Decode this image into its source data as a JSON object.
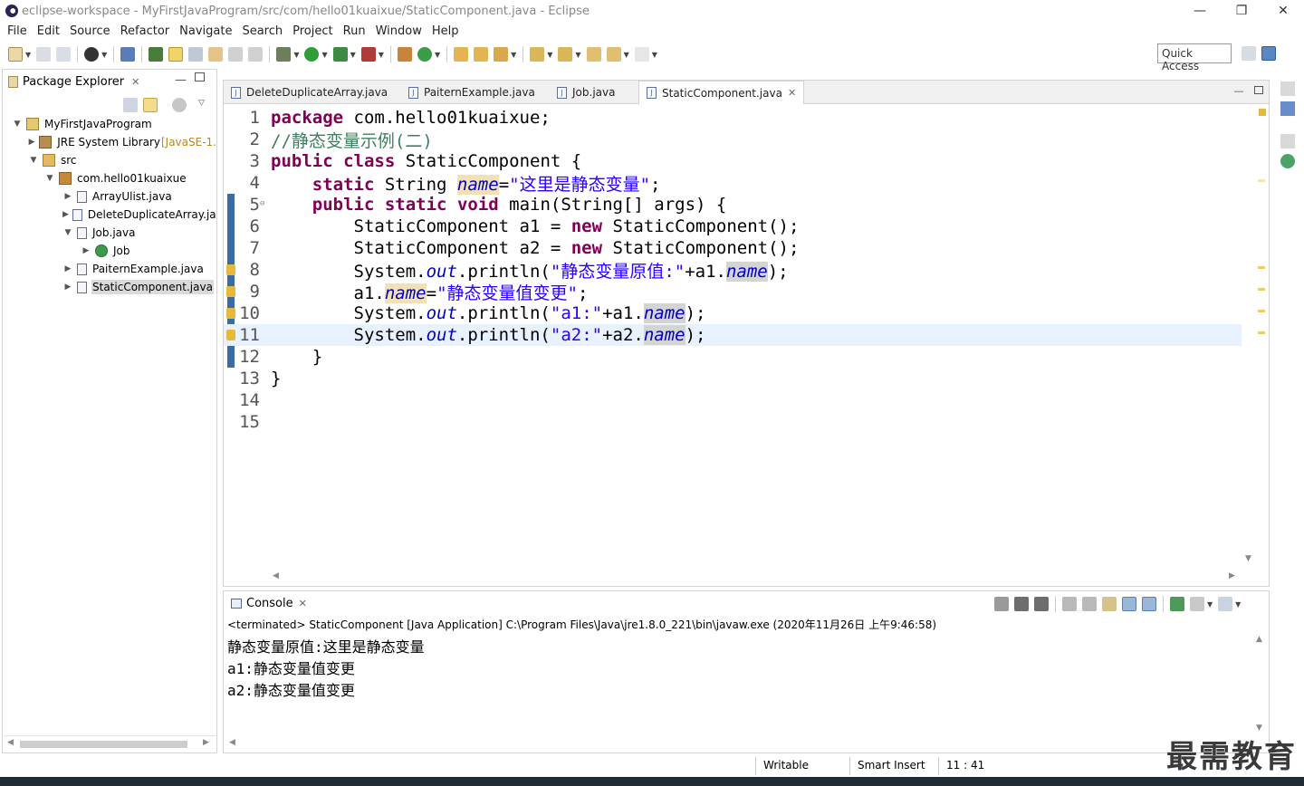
{
  "window": {
    "title": "eclipse-workspace - MyFirstJavaProgram/src/com/hello01kuaixue/StaticComponent.java - Eclipse",
    "minimize": "—",
    "restore": "❐",
    "close": "✕"
  },
  "menu": [
    "File",
    "Edit",
    "Source",
    "Refactor",
    "Navigate",
    "Search",
    "Project",
    "Run",
    "Window",
    "Help"
  ],
  "toolbar": {
    "quick_access": "Quick Access"
  },
  "package_explorer": {
    "title": "Package Explorer",
    "close": "✕",
    "tree": [
      {
        "label": "MyFirstJavaProgram",
        "decoration": "",
        "twisty": "▼",
        "icon": "project-icon"
      },
      {
        "label": "JRE System Library ",
        "decoration": "[JavaSE-1.",
        "twisty": "▶",
        "icon": "library-icon"
      },
      {
        "label": "src",
        "decoration": "",
        "twisty": "▼",
        "icon": "source-folder-icon"
      },
      {
        "label": "com.hello01kuaixue",
        "decoration": "",
        "twisty": "▼",
        "icon": "package-icon"
      },
      {
        "label": "ArrayUlist.java",
        "decoration": "",
        "twisty": "▶",
        "icon": "java-file-icon"
      },
      {
        "label": "DeleteDuplicateArray.ja",
        "decoration": "",
        "twisty": "▶",
        "icon": "java-file-icon"
      },
      {
        "label": "Job.java",
        "decoration": "",
        "twisty": "▼",
        "icon": "java-file-icon"
      },
      {
        "label": "Job",
        "decoration": "",
        "twisty": "▶",
        "icon": "class-icon"
      },
      {
        "label": "PaiternExample.java",
        "decoration": "",
        "twisty": "▶",
        "icon": "java-file-icon"
      },
      {
        "label": "StaticComponent.java",
        "decoration": "",
        "twisty": "▶",
        "icon": "java-file-icon"
      }
    ]
  },
  "editor": {
    "tabs": [
      {
        "label": "DeleteDuplicateArray.java",
        "active": false
      },
      {
        "label": "PaiternExample.java",
        "active": false
      },
      {
        "label": "Job.java",
        "active": false
      },
      {
        "label": "StaticComponent.java",
        "active": true
      }
    ],
    "tab_close": "✕",
    "line_numbers": [
      "1",
      "2",
      "3",
      "4",
      "5",
      "6",
      "7",
      "8",
      "9",
      "10",
      "11",
      "12",
      "13",
      "14",
      "15"
    ],
    "lines": [
      [
        {
          "t": "package",
          "c": "kw"
        },
        {
          "t": " com.hello01kuaixue;",
          "c": ""
        }
      ],
      [
        {
          "t": "//静态变量示例(二)",
          "c": "cmt"
        }
      ],
      [
        {
          "t": "public",
          "c": "kw"
        },
        {
          "t": " ",
          "c": ""
        },
        {
          "t": "class",
          "c": "kw"
        },
        {
          "t": " StaticComponent {",
          "c": ""
        }
      ],
      [
        {
          "t": "    ",
          "c": ""
        },
        {
          "t": "static",
          "c": "kw"
        },
        {
          "t": " String ",
          "c": ""
        },
        {
          "t": "name",
          "c": "fld occ"
        },
        {
          "t": "=",
          "c": ""
        },
        {
          "t": "\"这里是静态变量\"",
          "c": "str"
        },
        {
          "t": ";",
          "c": ""
        }
      ],
      [
        {
          "t": "    ",
          "c": ""
        },
        {
          "t": "public",
          "c": "kw"
        },
        {
          "t": " ",
          "c": ""
        },
        {
          "t": "static",
          "c": "kw"
        },
        {
          "t": " ",
          "c": ""
        },
        {
          "t": "void",
          "c": "kw"
        },
        {
          "t": " main(String[] args) {",
          "c": ""
        }
      ],
      [
        {
          "t": "        StaticComponent a1 = ",
          "c": ""
        },
        {
          "t": "new",
          "c": "kw"
        },
        {
          "t": " StaticComponent();",
          "c": ""
        }
      ],
      [
        {
          "t": "        StaticComponent a2 = ",
          "c": ""
        },
        {
          "t": "new",
          "c": "kw"
        },
        {
          "t": " StaticComponent();",
          "c": ""
        }
      ],
      [
        {
          "t": "        System.",
          "c": ""
        },
        {
          "t": "out",
          "c": "fld"
        },
        {
          "t": ".println(",
          "c": ""
        },
        {
          "t": "\"静态变量原值:\"",
          "c": "str"
        },
        {
          "t": "+a1.",
          "c": ""
        },
        {
          "t": "name",
          "c": "fld occ2"
        },
        {
          "t": ");",
          "c": ""
        }
      ],
      [
        {
          "t": "        a1.",
          "c": ""
        },
        {
          "t": "name",
          "c": "fld occ"
        },
        {
          "t": "=",
          "c": ""
        },
        {
          "t": "\"静态变量值变更\"",
          "c": "str"
        },
        {
          "t": ";",
          "c": ""
        }
      ],
      [
        {
          "t": "        System.",
          "c": ""
        },
        {
          "t": "out",
          "c": "fld"
        },
        {
          "t": ".println(",
          "c": ""
        },
        {
          "t": "\"a1:\"",
          "c": "str"
        },
        {
          "t": "+a1.",
          "c": ""
        },
        {
          "t": "name",
          "c": "fld occ2"
        },
        {
          "t": ");",
          "c": ""
        }
      ],
      [
        {
          "t": "        System.",
          "c": ""
        },
        {
          "t": "out",
          "c": "fld"
        },
        {
          "t": ".println(",
          "c": ""
        },
        {
          "t": "\"a2:\"",
          "c": "str"
        },
        {
          "t": "+a2.",
          "c": ""
        },
        {
          "t": "name",
          "c": "fld occ2"
        },
        {
          "t": ");",
          "c": ""
        }
      ],
      [
        {
          "t": "    }",
          "c": ""
        }
      ],
      [
        {
          "t": "}",
          "c": ""
        }
      ],
      [],
      []
    ],
    "current_line": 11,
    "warning_lines": [
      8,
      9,
      10,
      11
    ]
  },
  "console": {
    "title": "Console",
    "close": "✕",
    "status": "<terminated> StaticComponent [Java Application] C:\\Program Files\\Java\\jre1.8.0_221\\bin\\javaw.exe (2020年11月26日 上午9:46:58)",
    "output": [
      "静态变量原值:这里是静态变量",
      "a1:静态变量值变更",
      "a2:静态变量值变更"
    ]
  },
  "statusbar": {
    "writable": "Writable",
    "insert_mode": "Smart Insert",
    "position": "11 : 41"
  },
  "watermark": "最需教育",
  "colors": {
    "keyword": "#7f0055",
    "string": "#2a00ff",
    "comment": "#3f7f5f",
    "field": "#0000c0",
    "current_line": "#e8f2fe"
  }
}
